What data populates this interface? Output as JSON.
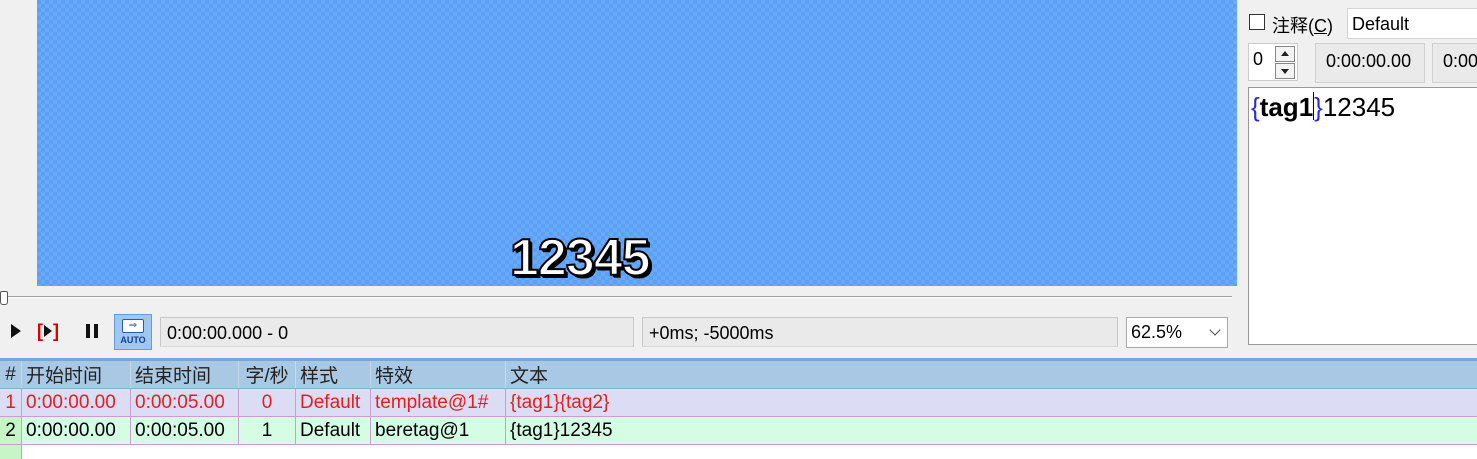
{
  "video": {
    "subtitle_text": "12345"
  },
  "transport": {
    "play_line_label": "[▶]",
    "auto_label": "AUTO",
    "current_time": "0:00:00.000 - 0",
    "offset": "+0ms; -5000ms",
    "zoom": "62.5%"
  },
  "edit": {
    "comment_label": "注释(",
    "comment_key": "C",
    "comment_close": ")",
    "style": "Default",
    "layer": "0",
    "start_time": "0:00:00.00",
    "end_time_partial": "0:00",
    "text_brace_open": "{",
    "text_tag": "tag1",
    "text_brace_close": "}",
    "text_rest": "12345"
  },
  "grid": {
    "headers": [
      "#",
      "开始时间",
      "结束时间",
      "字/秒",
      "样式",
      "特效",
      "文本"
    ],
    "rows": [
      {
        "num": "1",
        "start": "0:00:00.00",
        "end": "0:00:05.00",
        "cps": "0",
        "style": "Default",
        "effect": "template@1#",
        "text": "{tag1}{tag2}"
      },
      {
        "num": "2",
        "start": "0:00:00.00",
        "end": "0:00:05.00",
        "cps": "1",
        "style": "Default",
        "effect": "beretag@1",
        "text": "{tag1}12345"
      }
    ]
  },
  "colors": {
    "video_bg": "#5aa0f5",
    "comment_row_text": "#e02020",
    "comment_row_bg": "#dcdcf4",
    "selected_row_bg": "#d4fde4",
    "header_bg": "#a9c8e4"
  }
}
